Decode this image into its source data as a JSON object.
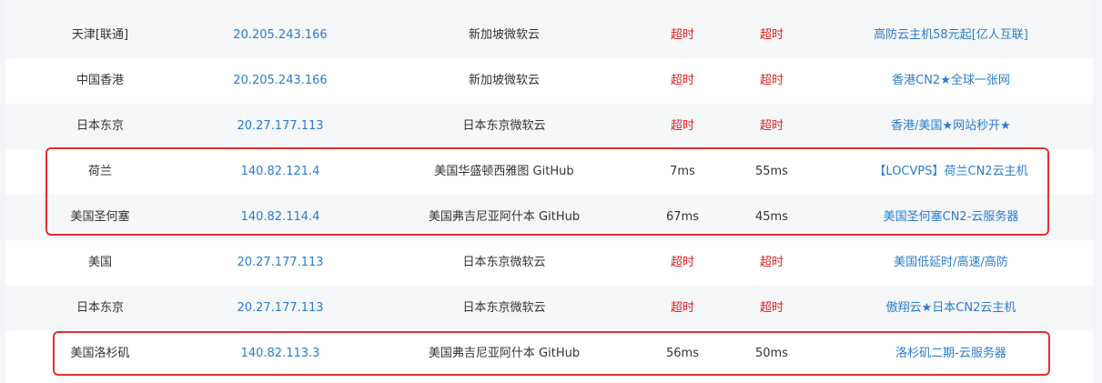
{
  "rows": [
    {
      "location": "天津[联通]",
      "ip": "20.205.243.166",
      "ip_location": "新加坡微软云",
      "ping1": "超时",
      "ping2": "超时",
      "ad": "高防云主机58元起[亿人互联]"
    },
    {
      "location": "中国香港",
      "ip": "20.205.243.166",
      "ip_location": "新加坡微软云",
      "ping1": "超时",
      "ping2": "超时",
      "ad": "香港CN2★全球一张网"
    },
    {
      "location": "日本东京",
      "ip": "20.27.177.113",
      "ip_location": "日本东京微软云",
      "ping1": "超时",
      "ping2": "超时",
      "ad": "香港/美国★网站秒开★"
    },
    {
      "location": "荷兰",
      "ip": "140.82.121.4",
      "ip_location": "美国华盛顿西雅图 GitHub",
      "ping1": "7ms",
      "ping2": "55ms",
      "ad": "【LOCVPS】荷兰CN2云主机"
    },
    {
      "location": "美国圣何塞",
      "ip": "140.82.114.4",
      "ip_location": "美国弗吉尼亚阿什本 GitHub",
      "ping1": "67ms",
      "ping2": "45ms",
      "ad": "美国圣何塞CN2-云服务器"
    },
    {
      "location": "美国",
      "ip": "20.27.177.113",
      "ip_location": "日本东京微软云",
      "ping1": "超时",
      "ping2": "超时",
      "ad": "美国低延时/高速/高防"
    },
    {
      "location": "日本东京",
      "ip": "20.27.177.113",
      "ip_location": "日本东京微软云",
      "ping1": "超时",
      "ping2": "超时",
      "ad": "傲翔云★日本CN2云主机"
    },
    {
      "location": "美国洛杉矶",
      "ip": "140.82.113.3",
      "ip_location": "美国弗吉尼亚阿什本 GitHub",
      "ping1": "56ms",
      "ping2": "50ms",
      "ad": "洛杉矶二期-云服务器"
    }
  ],
  "colors": {
    "link": "#2a7ccf",
    "timeout": "#e02020",
    "highlight": "#e23030",
    "row_alt": "#f6f7f9"
  }
}
